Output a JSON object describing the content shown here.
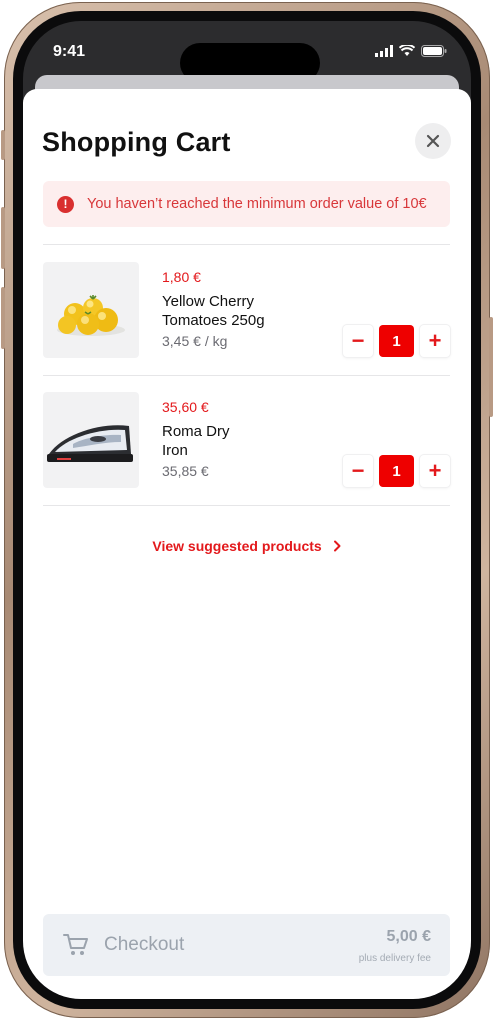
{
  "status_bar": {
    "time": "9:41"
  },
  "header": {
    "title": "Shopping Cart",
    "close_icon": "close-icon"
  },
  "alert": {
    "icon": "info-icon",
    "icon_glyph": "!",
    "text": "You haven’t reached the minimum order value of 10€"
  },
  "items": [
    {
      "price": "1,80 €",
      "name": "Yellow Cherry Tomatoes 250g",
      "unit_price": "3,45 € / kg",
      "quantity": "1",
      "minus": "−",
      "plus": "+"
    },
    {
      "price": "35,60 €",
      "name": "Roma Dry Iron",
      "unit_price": "35,85 €",
      "quantity": "1",
      "minus": "−",
      "plus": "+"
    }
  ],
  "suggested_link": "View suggested products",
  "checkout": {
    "label": "Checkout",
    "total": "5,00 €",
    "note": "plus delivery fee",
    "icon": "cart-icon"
  },
  "colors": {
    "accent": "#ee0000",
    "alert_bg": "#fdeeee",
    "alert_text": "#d8373a",
    "checkout_bg": "#edf0f4"
  }
}
